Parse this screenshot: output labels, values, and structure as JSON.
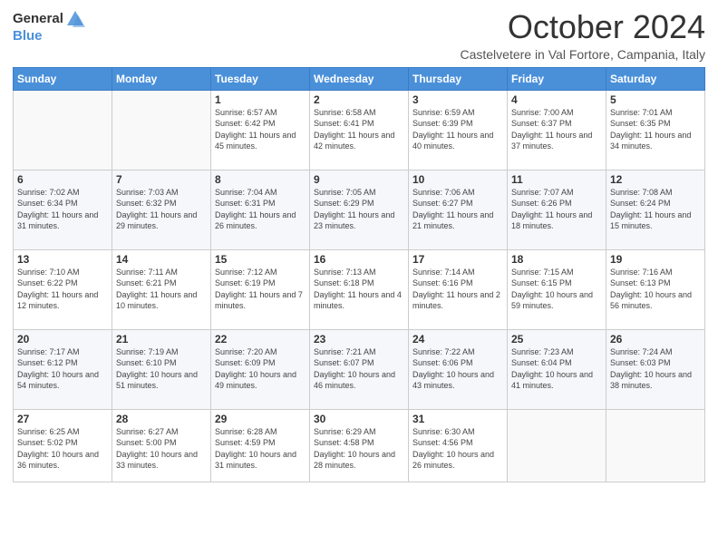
{
  "logo": {
    "general": "General",
    "blue": "Blue"
  },
  "title": "October 2024",
  "location": "Castelvetere in Val Fortore, Campania, Italy",
  "weekdays": [
    "Sunday",
    "Monday",
    "Tuesday",
    "Wednesday",
    "Thursday",
    "Friday",
    "Saturday"
  ],
  "weeks": [
    [
      {
        "day": "",
        "sunrise": "",
        "sunset": "",
        "daylight": ""
      },
      {
        "day": "",
        "sunrise": "",
        "sunset": "",
        "daylight": ""
      },
      {
        "day": "1",
        "sunrise": "Sunrise: 6:57 AM",
        "sunset": "Sunset: 6:42 PM",
        "daylight": "Daylight: 11 hours and 45 minutes."
      },
      {
        "day": "2",
        "sunrise": "Sunrise: 6:58 AM",
        "sunset": "Sunset: 6:41 PM",
        "daylight": "Daylight: 11 hours and 42 minutes."
      },
      {
        "day": "3",
        "sunrise": "Sunrise: 6:59 AM",
        "sunset": "Sunset: 6:39 PM",
        "daylight": "Daylight: 11 hours and 40 minutes."
      },
      {
        "day": "4",
        "sunrise": "Sunrise: 7:00 AM",
        "sunset": "Sunset: 6:37 PM",
        "daylight": "Daylight: 11 hours and 37 minutes."
      },
      {
        "day": "5",
        "sunrise": "Sunrise: 7:01 AM",
        "sunset": "Sunset: 6:35 PM",
        "daylight": "Daylight: 11 hours and 34 minutes."
      }
    ],
    [
      {
        "day": "6",
        "sunrise": "Sunrise: 7:02 AM",
        "sunset": "Sunset: 6:34 PM",
        "daylight": "Daylight: 11 hours and 31 minutes."
      },
      {
        "day": "7",
        "sunrise": "Sunrise: 7:03 AM",
        "sunset": "Sunset: 6:32 PM",
        "daylight": "Daylight: 11 hours and 29 minutes."
      },
      {
        "day": "8",
        "sunrise": "Sunrise: 7:04 AM",
        "sunset": "Sunset: 6:31 PM",
        "daylight": "Daylight: 11 hours and 26 minutes."
      },
      {
        "day": "9",
        "sunrise": "Sunrise: 7:05 AM",
        "sunset": "Sunset: 6:29 PM",
        "daylight": "Daylight: 11 hours and 23 minutes."
      },
      {
        "day": "10",
        "sunrise": "Sunrise: 7:06 AM",
        "sunset": "Sunset: 6:27 PM",
        "daylight": "Daylight: 11 hours and 21 minutes."
      },
      {
        "day": "11",
        "sunrise": "Sunrise: 7:07 AM",
        "sunset": "Sunset: 6:26 PM",
        "daylight": "Daylight: 11 hours and 18 minutes."
      },
      {
        "day": "12",
        "sunrise": "Sunrise: 7:08 AM",
        "sunset": "Sunset: 6:24 PM",
        "daylight": "Daylight: 11 hours and 15 minutes."
      }
    ],
    [
      {
        "day": "13",
        "sunrise": "Sunrise: 7:10 AM",
        "sunset": "Sunset: 6:22 PM",
        "daylight": "Daylight: 11 hours and 12 minutes."
      },
      {
        "day": "14",
        "sunrise": "Sunrise: 7:11 AM",
        "sunset": "Sunset: 6:21 PM",
        "daylight": "Daylight: 11 hours and 10 minutes."
      },
      {
        "day": "15",
        "sunrise": "Sunrise: 7:12 AM",
        "sunset": "Sunset: 6:19 PM",
        "daylight": "Daylight: 11 hours and 7 minutes."
      },
      {
        "day": "16",
        "sunrise": "Sunrise: 7:13 AM",
        "sunset": "Sunset: 6:18 PM",
        "daylight": "Daylight: 11 hours and 4 minutes."
      },
      {
        "day": "17",
        "sunrise": "Sunrise: 7:14 AM",
        "sunset": "Sunset: 6:16 PM",
        "daylight": "Daylight: 11 hours and 2 minutes."
      },
      {
        "day": "18",
        "sunrise": "Sunrise: 7:15 AM",
        "sunset": "Sunset: 6:15 PM",
        "daylight": "Daylight: 10 hours and 59 minutes."
      },
      {
        "day": "19",
        "sunrise": "Sunrise: 7:16 AM",
        "sunset": "Sunset: 6:13 PM",
        "daylight": "Daylight: 10 hours and 56 minutes."
      }
    ],
    [
      {
        "day": "20",
        "sunrise": "Sunrise: 7:17 AM",
        "sunset": "Sunset: 6:12 PM",
        "daylight": "Daylight: 10 hours and 54 minutes."
      },
      {
        "day": "21",
        "sunrise": "Sunrise: 7:19 AM",
        "sunset": "Sunset: 6:10 PM",
        "daylight": "Daylight: 10 hours and 51 minutes."
      },
      {
        "day": "22",
        "sunrise": "Sunrise: 7:20 AM",
        "sunset": "Sunset: 6:09 PM",
        "daylight": "Daylight: 10 hours and 49 minutes."
      },
      {
        "day": "23",
        "sunrise": "Sunrise: 7:21 AM",
        "sunset": "Sunset: 6:07 PM",
        "daylight": "Daylight: 10 hours and 46 minutes."
      },
      {
        "day": "24",
        "sunrise": "Sunrise: 7:22 AM",
        "sunset": "Sunset: 6:06 PM",
        "daylight": "Daylight: 10 hours and 43 minutes."
      },
      {
        "day": "25",
        "sunrise": "Sunrise: 7:23 AM",
        "sunset": "Sunset: 6:04 PM",
        "daylight": "Daylight: 10 hours and 41 minutes."
      },
      {
        "day": "26",
        "sunrise": "Sunrise: 7:24 AM",
        "sunset": "Sunset: 6:03 PM",
        "daylight": "Daylight: 10 hours and 38 minutes."
      }
    ],
    [
      {
        "day": "27",
        "sunrise": "Sunrise: 6:25 AM",
        "sunset": "Sunset: 5:02 PM",
        "daylight": "Daylight: 10 hours and 36 minutes."
      },
      {
        "day": "28",
        "sunrise": "Sunrise: 6:27 AM",
        "sunset": "Sunset: 5:00 PM",
        "daylight": "Daylight: 10 hours and 33 minutes."
      },
      {
        "day": "29",
        "sunrise": "Sunrise: 6:28 AM",
        "sunset": "Sunset: 4:59 PM",
        "daylight": "Daylight: 10 hours and 31 minutes."
      },
      {
        "day": "30",
        "sunrise": "Sunrise: 6:29 AM",
        "sunset": "Sunset: 4:58 PM",
        "daylight": "Daylight: 10 hours and 28 minutes."
      },
      {
        "day": "31",
        "sunrise": "Sunrise: 6:30 AM",
        "sunset": "Sunset: 4:56 PM",
        "daylight": "Daylight: 10 hours and 26 minutes."
      },
      {
        "day": "",
        "sunrise": "",
        "sunset": "",
        "daylight": ""
      },
      {
        "day": "",
        "sunrise": "",
        "sunset": "",
        "daylight": ""
      }
    ]
  ]
}
